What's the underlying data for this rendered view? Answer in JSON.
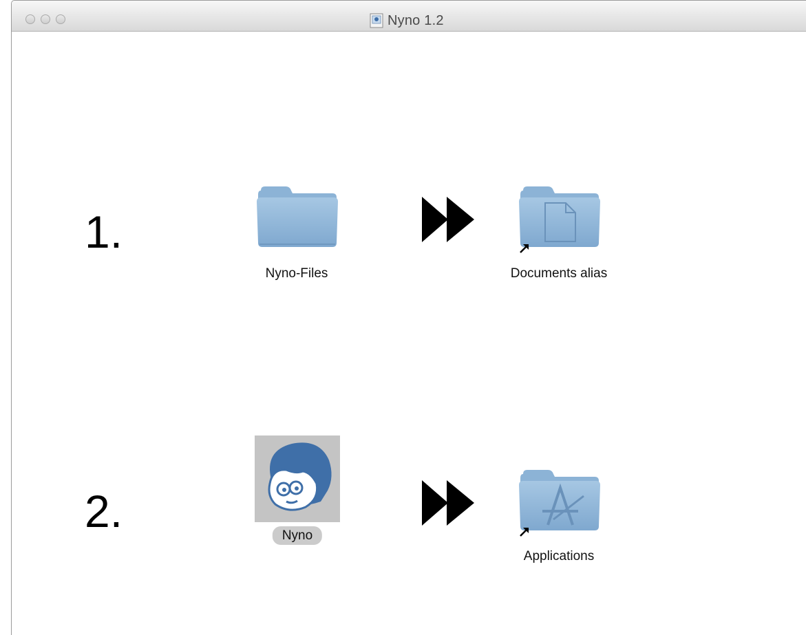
{
  "window": {
    "title": "Nyno 1.2"
  },
  "steps": [
    {
      "number": "1.",
      "source": {
        "label": "Nyno-Files",
        "icon": "folder-icon"
      },
      "target": {
        "label": "Documents alias",
        "icon": "documents-folder-alias-icon"
      }
    },
    {
      "number": "2.",
      "source": {
        "label": "Nyno",
        "icon": "nyno-app-icon",
        "selected": true
      },
      "target": {
        "label": "Applications",
        "icon": "applications-folder-alias-icon"
      }
    }
  ],
  "colors": {
    "folder": "#8fb6d8",
    "nyno_blue": "#3f6fa8",
    "selection_bg": "#cbcbcb"
  }
}
